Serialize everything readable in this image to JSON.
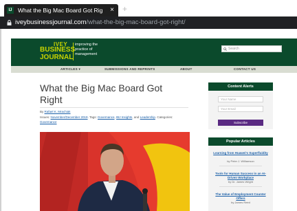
{
  "browser": {
    "tab_title": "What the Big Mac Board Got Rig",
    "favicon_text": "IJ",
    "close_glyph": "×",
    "new_tab_glyph": "+",
    "url_domain": "iveybusinessjournal.com",
    "url_path": "/what-the-big-mac-board-got-right/"
  },
  "site": {
    "logo_ivey": "IVEY",
    "logo_business": "BUSINESS",
    "logo_journal": "JOURNAL",
    "tagline": "improving the practice of management",
    "search_placeholder": "Search",
    "colors": {
      "brand_green": "#0b4a2c",
      "brand_lime": "#c8d400",
      "subscribe_purple": "#5a2a82",
      "link_blue": "#1a5fa8"
    }
  },
  "nav": {
    "articles": "ARTICLES ▾",
    "submissions": "SUBMISSIONS AND REPRINTS",
    "about": "ABOUT",
    "contact": "CONTACT US"
  },
  "article": {
    "title_line1": "What the Big Mac Board Got",
    "title_line2": "Right",
    "by_label": "By",
    "author": "Rafael K. Mrachiak",
    "issues_label": "Issues:",
    "issue": "November/December 2019",
    "tags_label": "Tags:",
    "tag1": "Governance",
    "tag2": "IBJ Insights",
    "tags_and": "and",
    "tag3": "Leadership",
    "categories_label": "Categories:",
    "category": "Governance"
  },
  "sidebar": {
    "alerts_heading": "Content Alerts",
    "name_placeholder": "Your Name",
    "email_placeholder": "Your Email",
    "subscribe_label": "Subscribe",
    "popular_heading": "Popular Articles",
    "popular": [
      {
        "title": "Learning from Huawei's Superfluidity",
        "author": "by Peter J. Williamson"
      },
      {
        "title": "Tools for Human Success in an AI-Driven Workplace",
        "author": "by Dr. James Wright"
      },
      {
        "title": "The Value of Employment Counter Offers",
        "author": "by James Reed"
      }
    ]
  }
}
